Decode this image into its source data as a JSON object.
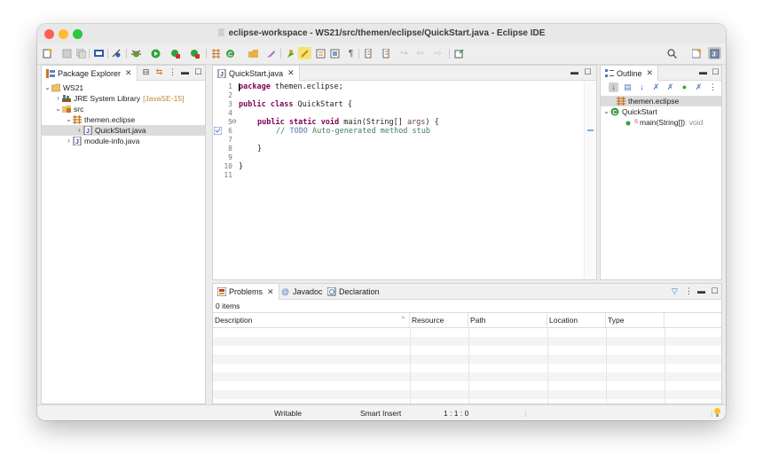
{
  "window": {
    "title": "eclipse-workspace - WS21/src/themen/eclipse/QuickStart.java - Eclipse IDE",
    "traffic_colors": {
      "close": "#ff5f57",
      "minimize": "#febc2e",
      "zoom": "#28c840"
    }
  },
  "toolbar": {
    "icons": [
      "new-icon",
      "save-icon",
      "save-all-icon",
      "terminal-icon",
      "skip-breakpoints-icon",
      "debug-icon",
      "run-icon",
      "coverage-icon",
      "external-tools-icon",
      "new-java-project-icon",
      "new-package-icon",
      "new-class-icon",
      "open-type-icon",
      "search-icon",
      "next-annotation-icon",
      "toggle-mark-occurrences-icon",
      "toggle-block-selection-icon",
      "show-whitespace-icon",
      "next-edit-icon",
      "previous-edit-icon",
      "back-icon",
      "forward-icon",
      "pin-editor-icon"
    ],
    "right_icons": [
      "quick-access-search-icon",
      "open-perspective-icon",
      "java-perspective-icon"
    ]
  },
  "package_explorer": {
    "tab_label": "Package Explorer",
    "tree": [
      {
        "label": "WS21",
        "suffix": "",
        "expanded": true,
        "icon": "project-icon"
      },
      {
        "label": "JRE System Library",
        "suffix": "[JavaSE-15]",
        "expanded": false,
        "icon": "library-icon"
      },
      {
        "label": "src",
        "suffix": "",
        "expanded": true,
        "icon": "source-folder-icon"
      },
      {
        "label": "themen.eclipse",
        "suffix": "",
        "expanded": true,
        "icon": "package-icon"
      },
      {
        "label": "QuickStart.java",
        "suffix": "",
        "expanded": false,
        "icon": "java-file-icon",
        "selected": true
      },
      {
        "label": "module-info.java",
        "suffix": "",
        "expanded": false,
        "icon": "java-file-icon"
      }
    ]
  },
  "editor": {
    "tab_label": "QuickStart.java",
    "line_numbers": [
      "1",
      "2",
      "3",
      "4",
      "5",
      "6",
      "7",
      "8",
      "9",
      "10",
      "11"
    ],
    "lines": {
      "l1_kw": "package",
      "l1_rest": " themen.eclipse;",
      "l3_kw1": "public",
      "l3_kw2": "class",
      "l3_rest": " QuickStart {",
      "l5_kw1": "public",
      "l5_kw2": "static",
      "l5_kw3": "void",
      "l5_rest": " main(String[] ",
      "l5_arg": "args",
      "l5_end": ") {",
      "l6_slash": "// ",
      "l6_todo": "TODO",
      "l6_rest": " Auto-generated method stub",
      "l8": "}",
      "l10": "}"
    }
  },
  "outline": {
    "tab_label": "Outline",
    "items": [
      {
        "label": "themen.eclipse",
        "icon": "package-icon",
        "selected": true
      },
      {
        "label": "QuickStart",
        "icon": "class-icon",
        "expanded": true
      },
      {
        "label": "main(String[])",
        "suffix": " : void",
        "icon": "method-icon"
      }
    ]
  },
  "bottom_panel": {
    "tabs": [
      "Problems",
      "Javadoc",
      "Declaration"
    ],
    "count": "0 items",
    "columns": [
      "Description",
      "Resource",
      "Path",
      "Location",
      "Type"
    ]
  },
  "statusbar": {
    "writable": "Writable",
    "insert_mode": "Smart Insert",
    "position": "1 : 1 : 0"
  }
}
